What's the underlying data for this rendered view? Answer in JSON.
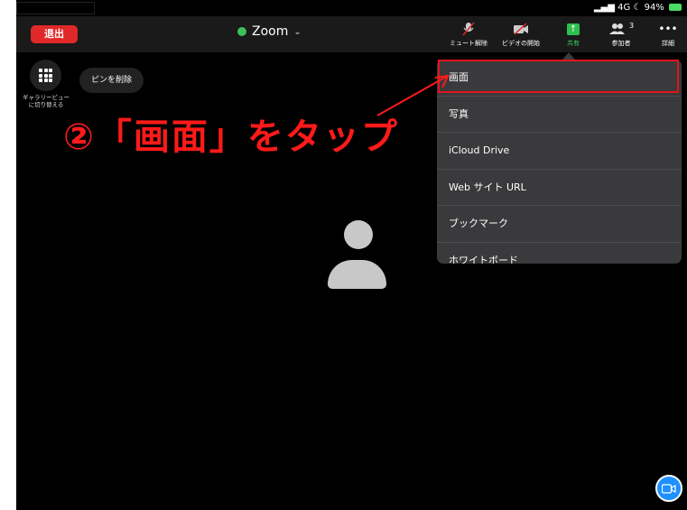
{
  "status_bar": {
    "right_text": "4G",
    "battery": "94%"
  },
  "topbar": {
    "leave_label": "退出",
    "meeting_title": "Zoom",
    "mute_label": "ミュート解除",
    "video_label": "ビデオの開始",
    "share_label": "共有",
    "participants_label": "参加者",
    "participants_count": "3",
    "more_label": "詳細"
  },
  "left_controls": {
    "gallery_label": "ギャラリービューに切り替える",
    "unpin_label": "ピンを削除"
  },
  "share_menu": {
    "items": [
      {
        "label": "画面"
      },
      {
        "label": "写真"
      },
      {
        "label": "iCloud Drive"
      },
      {
        "label": "Web サイト URL"
      },
      {
        "label": "ブックマーク"
      },
      {
        "label": "ホワイトボード"
      }
    ]
  },
  "annotation": {
    "text": "②「画面」をタップ"
  },
  "colors": {
    "leave": "#e02828",
    "share_accent": "#2fbf4f",
    "annotation": "#ff1a1a",
    "menu_bg": "#3a3a3c"
  },
  "icons": [
    "shield-icon",
    "chevron-down-icon",
    "mic-muted-icon",
    "video-off-icon",
    "share-icon",
    "participants-icon",
    "more-icon",
    "grid-icon",
    "avatar-icon",
    "video-camera-icon",
    "arrow-icon"
  ]
}
